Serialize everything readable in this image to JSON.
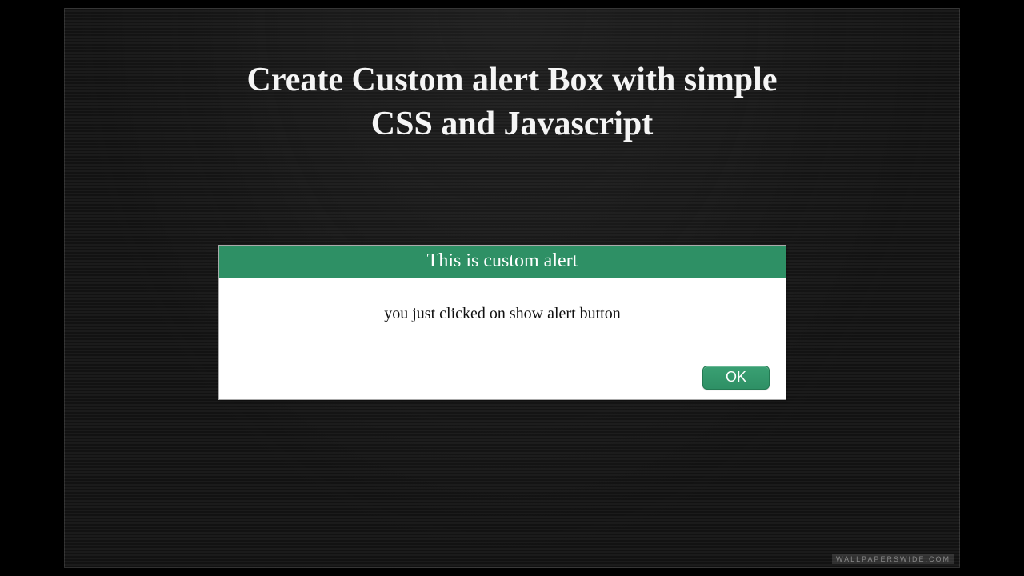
{
  "header": {
    "title_line1": "Create Custom alert Box with simple",
    "title_line2": "CSS and Javascript"
  },
  "alert": {
    "title": "This is custom alert",
    "message": "you just clicked on show alert button",
    "ok_label": "OK"
  },
  "footer": {
    "watermark": "WALLPAPERSWIDE.COM"
  },
  "colors": {
    "accent": "#2e9065"
  }
}
